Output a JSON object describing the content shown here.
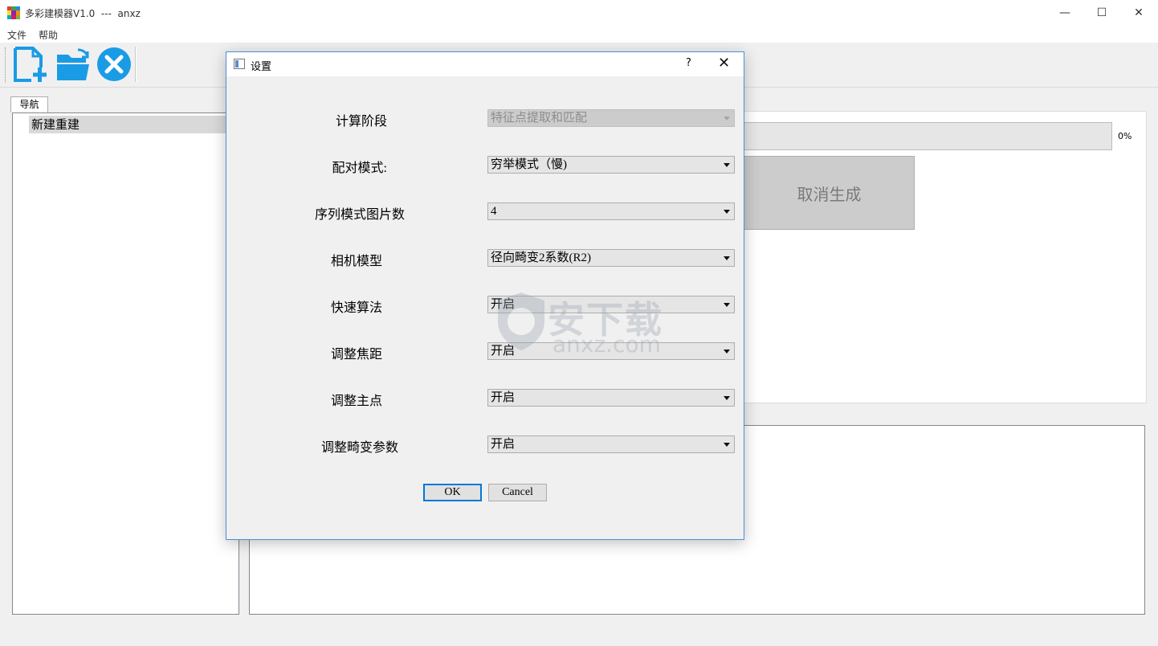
{
  "window": {
    "title": "多彩建模器V1.0  ---  anxz",
    "minimize_glyph": "—",
    "maximize_glyph": "☐",
    "close_glyph": "✕"
  },
  "menu": {
    "items": [
      "文件",
      "帮助"
    ]
  },
  "toolbar": {
    "buttons": [
      {
        "icon": "new-file-plus-icon"
      },
      {
        "icon": "open-folder-icon"
      },
      {
        "icon": "close-circle-icon"
      }
    ],
    "accent": "#1a9be6"
  },
  "nav": {
    "tab_label": "导航",
    "items": [
      "新建重建"
    ]
  },
  "progress": {
    "percent_text": "0%",
    "value": 0
  },
  "cancel_generate_label": "取消生成",
  "dialog": {
    "title": "设置",
    "help": "?",
    "close": "✕",
    "rows": [
      {
        "label": "计算阶段",
        "value": "特征点提取和匹配",
        "disabled": true
      },
      {
        "label": "配对模式:",
        "value": "穷举模式（慢)",
        "disabled": false
      },
      {
        "label": "序列模式图片数",
        "value": "4",
        "disabled": false
      },
      {
        "label": "相机模型",
        "value": "径向畸变2系数(R2)",
        "disabled": false
      },
      {
        "label": "快速算法",
        "value": "开启",
        "disabled": false
      },
      {
        "label": "调整焦距",
        "value": "开启",
        "disabled": false
      },
      {
        "label": "调整主点",
        "value": "开启",
        "disabled": false
      },
      {
        "label": "调整畸变参数",
        "value": "开启",
        "disabled": false
      }
    ],
    "ok_label": "OK",
    "cancel_label": "Cancel"
  },
  "watermark": {
    "cn": "安下载",
    "en": "anxz.com"
  }
}
